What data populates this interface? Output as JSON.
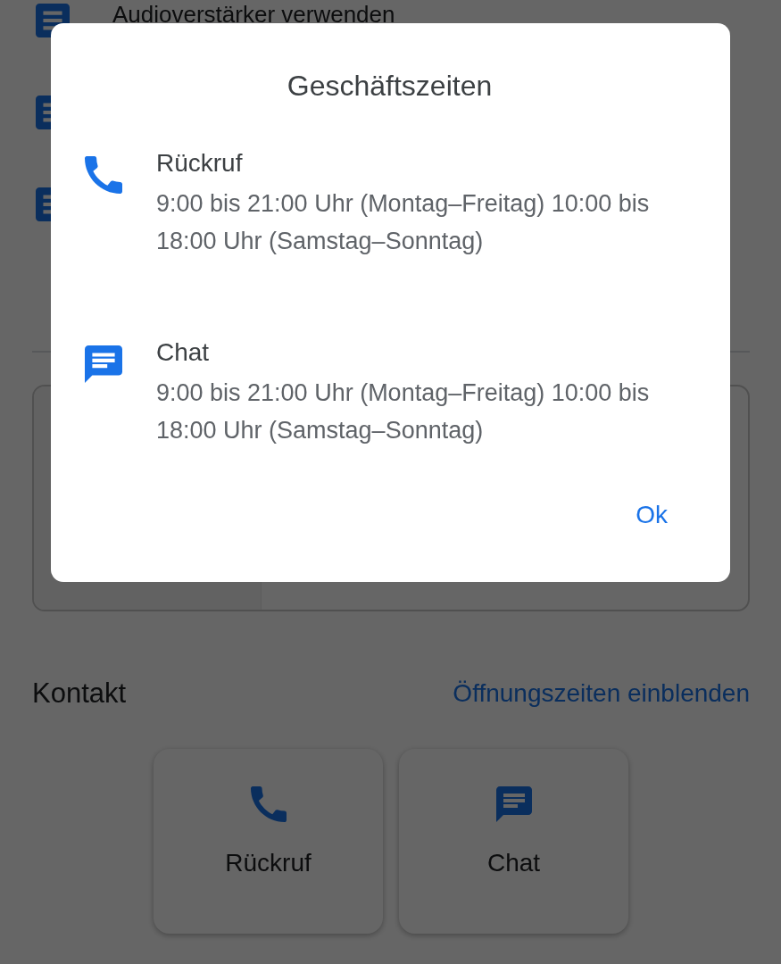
{
  "background": {
    "list_items": [
      {
        "kind": "article",
        "label": "Audioverstärker verwenden"
      },
      {
        "kind": "article"
      },
      {
        "kind": "article"
      }
    ],
    "contact": {
      "title": "Kontakt",
      "link": "Öffnungszeiten einblenden",
      "options": [
        {
          "kind": "phone",
          "label": "Rückruf"
        },
        {
          "kind": "chat",
          "label": "Chat"
        }
      ]
    }
  },
  "dialog": {
    "title": "Geschäftszeiten",
    "entries": [
      {
        "kind": "phone",
        "title": "Rückruf",
        "hours": "9:00 bis 21:00 Uhr (Montag–Freitag) 10:00 bis 18:00 Uhr (Samstag–Sonntag)"
      },
      {
        "kind": "chat",
        "title": "Chat",
        "hours": "9:00 bis 21:00 Uhr (Montag–Freitag) 10:00 bis 18:00 Uhr (Samstag–Sonntag)"
      }
    ],
    "button": "Ok"
  }
}
